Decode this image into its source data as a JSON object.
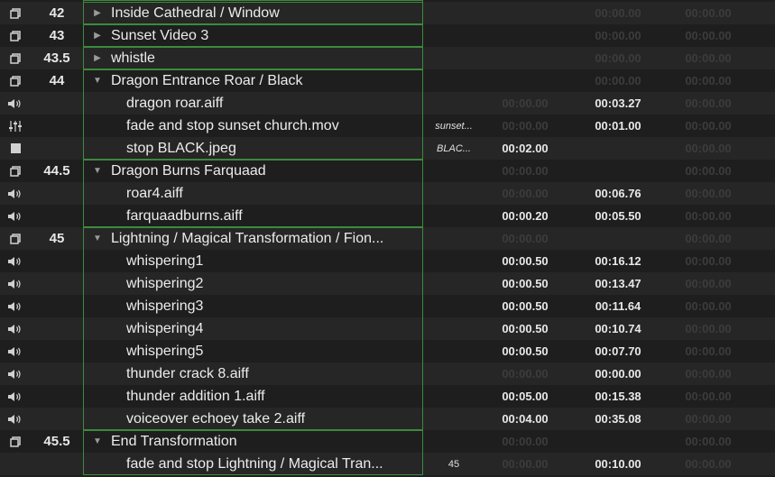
{
  "colors": {
    "row_alt": "#262626",
    "row_base": "#1e1e1e",
    "group_border": "#3d8a3d",
    "time_dim": "#3c3c3c",
    "time_lit": "#e8e8e8"
  },
  "rows": [
    {
      "kind": "group",
      "icon": "group-icon",
      "number": "42",
      "name": "Inside Cathedral / Window",
      "expanded": false,
      "target": "",
      "pre": "",
      "action": "00:00.00",
      "post": "00:00.00",
      "pre_lit": false,
      "action_lit": false,
      "post_lit": false
    },
    {
      "kind": "group",
      "icon": "group-icon",
      "number": "43",
      "name": "Sunset Video 3",
      "expanded": false,
      "target": "",
      "pre": "",
      "action": "00:00.00",
      "post": "00:00.00",
      "pre_lit": false,
      "action_lit": false,
      "post_lit": false
    },
    {
      "kind": "group",
      "icon": "group-icon",
      "number": "43.5",
      "name": "whistle",
      "expanded": false,
      "target": "",
      "pre": "",
      "action": "00:00.00",
      "post": "00:00.00",
      "pre_lit": false,
      "action_lit": false,
      "post_lit": false
    },
    {
      "kind": "group",
      "icon": "group-icon",
      "number": "44",
      "name": "Dragon Entrance Roar / Black",
      "expanded": true,
      "target": "",
      "pre": "",
      "action": "00:00.00",
      "post": "00:00.00",
      "pre_lit": false,
      "action_lit": false,
      "post_lit": false
    },
    {
      "kind": "child",
      "icon": "speaker-icon",
      "number": "",
      "name": "dragon roar.aiff",
      "target": "",
      "pre": "00:00.00",
      "action": "00:03.27",
      "post": "00:00.00",
      "pre_lit": false,
      "action_lit": true,
      "post_lit": false
    },
    {
      "kind": "child",
      "icon": "fader-icon",
      "number": "",
      "name": "fade and stop sunset church.mov",
      "target": "sunset...",
      "pre": "00:00.00",
      "action": "00:01.00",
      "post": "00:00.00",
      "pre_lit": false,
      "action_lit": true,
      "post_lit": false
    },
    {
      "kind": "child",
      "icon": "stop-icon",
      "number": "",
      "name": "stop BLACK.jpeg",
      "target": "BLAC...",
      "pre": "00:02.00",
      "action": "",
      "post": "00:00.00",
      "pre_lit": true,
      "action_lit": false,
      "post_lit": false
    },
    {
      "kind": "group",
      "icon": "group-icon",
      "number": "44.5",
      "name": "Dragon Burns Farquaad",
      "expanded": true,
      "target": "",
      "pre": "00:00.00",
      "action": "",
      "post": "00:00.00",
      "pre_lit": false,
      "action_lit": false,
      "post_lit": false
    },
    {
      "kind": "child",
      "icon": "speaker-icon",
      "number": "",
      "name": "roar4.aiff",
      "target": "",
      "pre": "00:00.00",
      "action": "00:06.76",
      "post": "00:00.00",
      "pre_lit": false,
      "action_lit": true,
      "post_lit": false
    },
    {
      "kind": "child",
      "icon": "speaker-icon",
      "number": "",
      "name": "farquaadburns.aiff",
      "target": "",
      "pre": "00:00.20",
      "action": "00:05.50",
      "post": "00:00.00",
      "pre_lit": true,
      "action_lit": true,
      "post_lit": false
    },
    {
      "kind": "group",
      "icon": "group-icon",
      "number": "45",
      "name": "Lightning / Magical Transformation / Fion...",
      "expanded": true,
      "target": "",
      "pre": "00:00.00",
      "action": "",
      "post": "00:00.00",
      "pre_lit": false,
      "action_lit": false,
      "post_lit": false
    },
    {
      "kind": "child",
      "icon": "speaker-icon",
      "number": "",
      "name": "whispering1",
      "target": "",
      "pre": "00:00.50",
      "action": "00:16.12",
      "post": "00:00.00",
      "pre_lit": true,
      "action_lit": true,
      "post_lit": false
    },
    {
      "kind": "child",
      "icon": "speaker-icon",
      "number": "",
      "name": "whispering2",
      "target": "",
      "pre": "00:00.50",
      "action": "00:13.47",
      "post": "00:00.00",
      "pre_lit": true,
      "action_lit": true,
      "post_lit": false
    },
    {
      "kind": "child",
      "icon": "speaker-icon",
      "number": "",
      "name": "whispering3",
      "target": "",
      "pre": "00:00.50",
      "action": "00:11.64",
      "post": "00:00.00",
      "pre_lit": true,
      "action_lit": true,
      "post_lit": false
    },
    {
      "kind": "child",
      "icon": "speaker-icon",
      "number": "",
      "name": "whispering4",
      "target": "",
      "pre": "00:00.50",
      "action": "00:10.74",
      "post": "00:00.00",
      "pre_lit": true,
      "action_lit": true,
      "post_lit": false
    },
    {
      "kind": "child",
      "icon": "speaker-icon",
      "number": "",
      "name": "whispering5",
      "target": "",
      "pre": "00:00.50",
      "action": "00:07.70",
      "post": "00:00.00",
      "pre_lit": true,
      "action_lit": true,
      "post_lit": false
    },
    {
      "kind": "child",
      "icon": "speaker-icon",
      "number": "",
      "name": "thunder crack 8.aiff",
      "target": "",
      "pre": "00:00.00",
      "action": "00:00.00",
      "post": "00:00.00",
      "pre_lit": false,
      "action_lit": true,
      "post_lit": false
    },
    {
      "kind": "child",
      "icon": "speaker-icon",
      "number": "",
      "name": "thunder addition 1.aiff",
      "target": "",
      "pre": "00:05.00",
      "action": "00:15.38",
      "post": "00:00.00",
      "pre_lit": true,
      "action_lit": true,
      "post_lit": false
    },
    {
      "kind": "child",
      "icon": "speaker-icon",
      "number": "",
      "name": "voiceover echoey take 2.aiff",
      "target": "",
      "pre": "00:04.00",
      "action": "00:35.08",
      "post": "00:00.00",
      "pre_lit": true,
      "action_lit": true,
      "post_lit": false
    },
    {
      "kind": "group",
      "icon": "group-icon",
      "number": "45.5",
      "name": "End Transformation",
      "expanded": true,
      "target": "",
      "pre": "00:00.00",
      "action": "",
      "post": "00:00.00",
      "pre_lit": false,
      "action_lit": false,
      "post_lit": false
    },
    {
      "kind": "child",
      "icon": "goto-icon",
      "number": "",
      "name": "fade and stop Lightning / Magical Tran...",
      "target": "45",
      "target_plain": true,
      "pre": "00:00.00",
      "action": "00:10.00",
      "post": "00:00.00",
      "pre_lit": false,
      "action_lit": true,
      "post_lit": false
    }
  ]
}
